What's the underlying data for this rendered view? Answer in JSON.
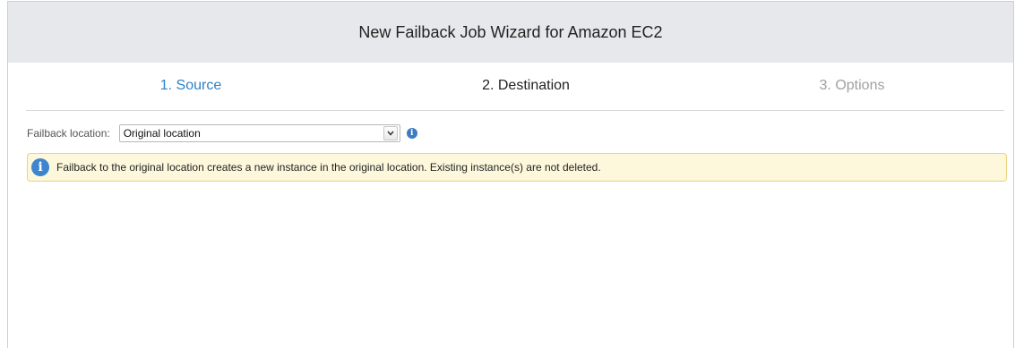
{
  "window": {
    "title": "New Failback Job Wizard for Amazon EC2"
  },
  "steps": [
    {
      "label": "1. Source",
      "state": "completed"
    },
    {
      "label": "2. Destination",
      "state": "active"
    },
    {
      "label": "3. Options",
      "state": "disabled"
    }
  ],
  "form": {
    "failback_location_label": "Failback location:",
    "failback_location_value": "Original location",
    "info_icon": "info-icon"
  },
  "banner": {
    "icon": "info-icon",
    "text": "Failback to the original location creates a new instance in the original location. Existing instance(s) are not deleted."
  },
  "colors": {
    "step_completed": "#2f80c4",
    "step_active": "#222222",
    "step_disabled": "#a0a0a0",
    "banner_bg": "#fdf8dc",
    "banner_border": "#e9d47f",
    "info_blue": "#3d86cf"
  }
}
